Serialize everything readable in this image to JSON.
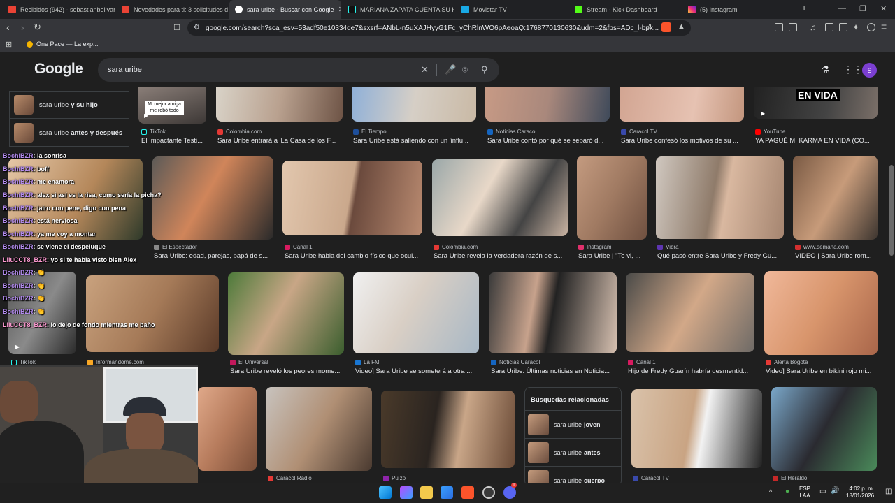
{
  "tabs": [
    {
      "title": "Recibidos (942) - sebastianbolivar90",
      "color": "#ea4335"
    },
    {
      "title": "Novedades para ti: 3 solicitudes de a",
      "color": "#ea4335"
    },
    {
      "title": "sara uribe - Buscar con Google",
      "color": "#4285f4"
    },
    {
      "title": "MARIANA ZAPATA CUENTA SU HISTO",
      "color": "#111111"
    },
    {
      "title": "Movistar TV",
      "color": "#19a9e5"
    },
    {
      "title": "Stream - Kick Dashboard",
      "color": "#53fc18"
    },
    {
      "title": "(5) Instagram",
      "color": "#e1306c"
    }
  ],
  "new_tab": "+",
  "address": {
    "url": "google.com/search?sca_esv=53adf50e10334de7&sxsrf=ANbL-n5uXAJHyyG1Fc_yChRlnWO6pAeoaQ:1768770130630&udm=2&fbs=ADc_l-bpk..."
  },
  "bookmarks": [
    {
      "label": "One Pace — La exp..."
    }
  ],
  "google": {
    "logo": "Google",
    "query": "sara uribe",
    "avatar_letter": "S"
  },
  "suggestions": [
    {
      "prefix": "sara uribe",
      "bold": "y su hijo"
    },
    {
      "prefix": "sara uribe",
      "bold": "antes y después"
    }
  ],
  "row1": [
    {
      "source": "TikTok",
      "title": "El Impactante Testi...",
      "fav": "#111111",
      "overlay": "Mi mejor amiga me robó todo"
    },
    {
      "source": "Colombia.com",
      "title": "Sara Uribe entrará a 'La Casa de los F...",
      "fav": "#e53935"
    },
    {
      "source": "El Tiempo",
      "title": "Sara Uribe está saliendo con un 'influ...",
      "fav": "#1e4f9b"
    },
    {
      "source": "Noticias Caracol",
      "title": "Sara Uribe contó por qué se separó d...",
      "fav": "#1565c0"
    },
    {
      "source": "Caracol TV",
      "title": "Sara Uribe confesó los motivos de su ...",
      "fav": "#3949ab"
    },
    {
      "source": "YouTube",
      "title": "YA PAGUÉ MI KARMA EN VIDA (CO...",
      "fav": "#ff0000",
      "overlay": "EN VIDA"
    }
  ],
  "row2": [
    {
      "source": "El Espectador",
      "title": "Sara Uribe: edad, parejas, papá de s...",
      "fav": "#888888"
    },
    {
      "source": "Canal 1",
      "title": "Sara Uribe habla del cambio físico que ocul...",
      "fav": "#d81b60"
    },
    {
      "source": "Colombia.com",
      "title": "Sara Uribe revela la verdadera razón de s...",
      "fav": "#e53935"
    },
    {
      "source": "Instagram",
      "title": "Sara Uribe | \"Te vi, ...",
      "fav": "#e1306c"
    },
    {
      "source": "Vibra",
      "title": "Qué pasó entre Sara Uribe y Fredy Gu...",
      "fav": "#5e35b1"
    },
    {
      "source": "www.semana.com",
      "title": "VIDEO | Sara Uribe rom...",
      "fav": "#d32f2f"
    }
  ],
  "row3": [
    {
      "source": "TikTok",
      "title": "",
      "fav": "#111111"
    },
    {
      "source": "Informandome.com",
      "title": "",
      "fav": "#f9a825"
    },
    {
      "source": "El Universal",
      "title": "Sara Uribe reveló los peores mome...",
      "fav": "#c2185b"
    },
    {
      "source": "La FM",
      "title": "Video] Sara Uribe se someterá a otra ...",
      "fav": "#1976d2"
    },
    {
      "source": "Noticias Caracol",
      "title": "Sara Uribe: Últimas noticias en Noticia...",
      "fav": "#1565c0"
    },
    {
      "source": "Canal 1",
      "title": "Hijo de Fredy Guarín habría desmentid...",
      "fav": "#d81b60"
    },
    {
      "source": "Alerta Bogotá",
      "title": "Video] Sara Uribe en bikini rojo mi...",
      "fav": "#e53935"
    }
  ],
  "row4": [
    {
      "source": "Caracol Radio",
      "fav": "#e53935"
    },
    {
      "source": "Pulzo",
      "fav": "#8e24aa"
    },
    {
      "source": "Caracol TV",
      "fav": "#3949ab"
    },
    {
      "source": "El Heraldo",
      "fav": "#c62828"
    }
  ],
  "related": {
    "heading": "Búsquedas relacionadas",
    "items": [
      {
        "prefix": "sara uribe",
        "bold": "joven"
      },
      {
        "prefix": "sara uribe",
        "bold": "antes"
      },
      {
        "prefix": "sara uribe",
        "bold": "cuerpo"
      }
    ]
  },
  "chat": [
    {
      "user": "BochiBZR",
      "msg": ": la sonrisa"
    },
    {
      "user": "BochiBZR",
      "msg": ": boff"
    },
    {
      "user": "BochiBZR",
      "msg": ": me enamora"
    },
    {
      "user": "BochiBZR",
      "msg": ": alex si así es la risa, como sería la picha?"
    },
    {
      "user": "BochiBZR",
      "msg": ": jairo con pene, digo con pena"
    },
    {
      "user": "BochiBZR",
      "msg": ": está nerviosa"
    },
    {
      "user": "BochiBZR",
      "msg": ": ya me voy a montar"
    },
    {
      "user": "BochiBZR",
      "msg": ": se viene el despeluque"
    },
    {
      "user": "LiluCCT8_BZR",
      "msg": ": yo si te habia visto bien Alex"
    },
    {
      "user": "BochiBZR",
      "msg": ": 👏"
    },
    {
      "user": "BochiBZR",
      "msg": ": 👏"
    },
    {
      "user": "BochiBZR",
      "msg": ": 👏"
    },
    {
      "user": "BochiBZR",
      "msg": ": 👏"
    },
    {
      "user": "LiluCCT8_BZR",
      "msg": ": lo dejo de fondo mientras me baño"
    }
  ],
  "taskbar": {
    "lang": "ESP",
    "lang2": "LAA",
    "time": "4:02 p. m.",
    "date": "18/01/2026",
    "notif_badge": "1"
  }
}
